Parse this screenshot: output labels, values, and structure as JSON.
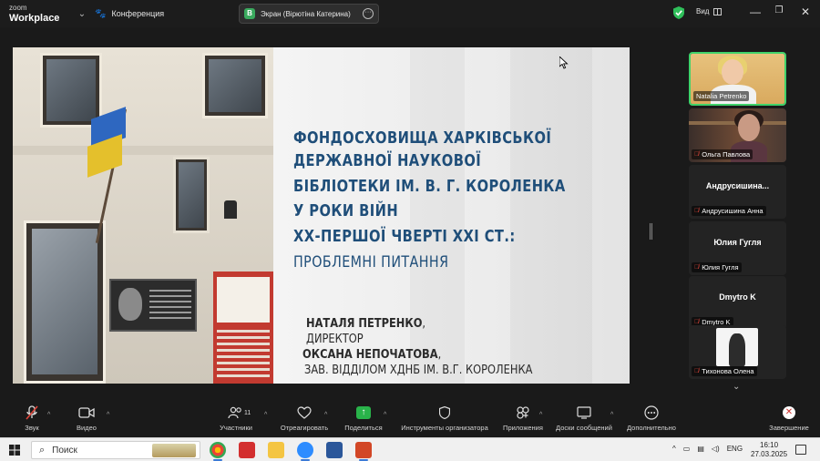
{
  "app": {
    "logo_line1": "zoom",
    "logo_line2": "Workplace",
    "meeting_label": "Конференция",
    "screen_share_label": "Экран (Вірютіна Катерина)",
    "screen_share_initial": "В",
    "view_label": "Вид"
  },
  "slide": {
    "title_lines": [
      "ФОНДОСХОВИЩА ХАРКІВСЬКОЇ",
      "ДЕРЖАВНОЇ НАУКОВОЇ",
      "БІБЛІОТЕКИ ІМ. В. Г. КОРОЛЕНКА",
      "У РОКИ ВІЙН",
      "ХХ-ПЕРШОЇ ЧВЕРТІ ХХІ СТ.:"
    ],
    "subtitle": "ПРОБЛЕМНІ ПИТАННЯ",
    "author1_name": "НАТАЛЯ ПЕТРЕНКО",
    "author1_comma": ",",
    "author1_role": "ДИРЕКТОР",
    "author2_name": "ОКСАНА НЕПОЧАТОВА",
    "author2_comma": ",",
    "author2_role": "ЗАВ. ВІДДІЛОМ ХДНБ ІМ. В.Г. КОРОЛЕНКА"
  },
  "participants": [
    {
      "name": "Natalia Petrenko",
      "video": true,
      "active": true,
      "muted": false
    },
    {
      "name": "Ольга Павлова",
      "video": true,
      "active": false,
      "muted": true
    },
    {
      "display": "Андрусишина...",
      "name": "Андрусишина Анна",
      "video": false,
      "muted": true
    },
    {
      "display": "Юлия Гугля",
      "name": "Юлия Гугля",
      "video": false,
      "muted": true
    },
    {
      "display": "Dmytro K",
      "name": "Dmytro K",
      "video": false,
      "muted": true
    },
    {
      "name": "Тихонова Олена",
      "video": true,
      "active": false,
      "muted": true
    }
  ],
  "toolbar": {
    "audio": "Звук",
    "video": "Видео",
    "participants": "Участники",
    "participants_count": "11",
    "react": "Отреагировать",
    "share": "Поделиться",
    "host_tools": "Инструменты организатора",
    "apps": "Приложения",
    "whiteboards": "Доски сообщений",
    "more": "Дополнительно",
    "end": "Завершение"
  },
  "taskbar": {
    "search_placeholder": "Поиск",
    "language": "ENG",
    "time": "16:10",
    "date": "27.03.2025"
  }
}
